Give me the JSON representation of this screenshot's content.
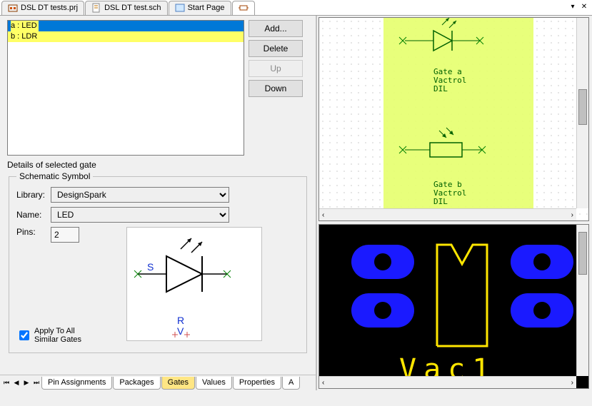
{
  "top_tabs": {
    "prj": "DSL DT tests.prj",
    "sch": "DSL DT test.sch",
    "start": "Start Page"
  },
  "gates_list": {
    "items": [
      {
        "label": "a : LED",
        "selected": true,
        "highlighted": true
      },
      {
        "label": "b : LDR",
        "selected": false,
        "highlighted": true
      }
    ]
  },
  "gate_buttons": {
    "add": "Add...",
    "delete": "Delete",
    "up": "Up",
    "down": "Down"
  },
  "details": {
    "title": "Details of selected gate",
    "group_title": "Schematic Symbol",
    "library_label": "Library:",
    "library_value": "DesignSpark",
    "name_label": "Name:",
    "name_value": "LED",
    "pins_label": "Pins:",
    "pins_value": "2",
    "apply_label_1": "Apply To All",
    "apply_label_2": "Similar Gates",
    "apply_checked": true,
    "preview_letters": {
      "s": "S",
      "r": "R",
      "v": "V"
    }
  },
  "bottom_tabs": {
    "pin_assignments": "Pin Assignments",
    "packages": "Packages",
    "gates": "Gates",
    "values": "Values",
    "properties": "Properties",
    "assoc": "A"
  },
  "schematic_view": {
    "gate_a_label": "Gate a\nVactrol\nDIL",
    "gate_b_label": "Gate b\nVactrol\nDIL"
  },
  "pcb_view": {
    "label": "Vac1"
  }
}
